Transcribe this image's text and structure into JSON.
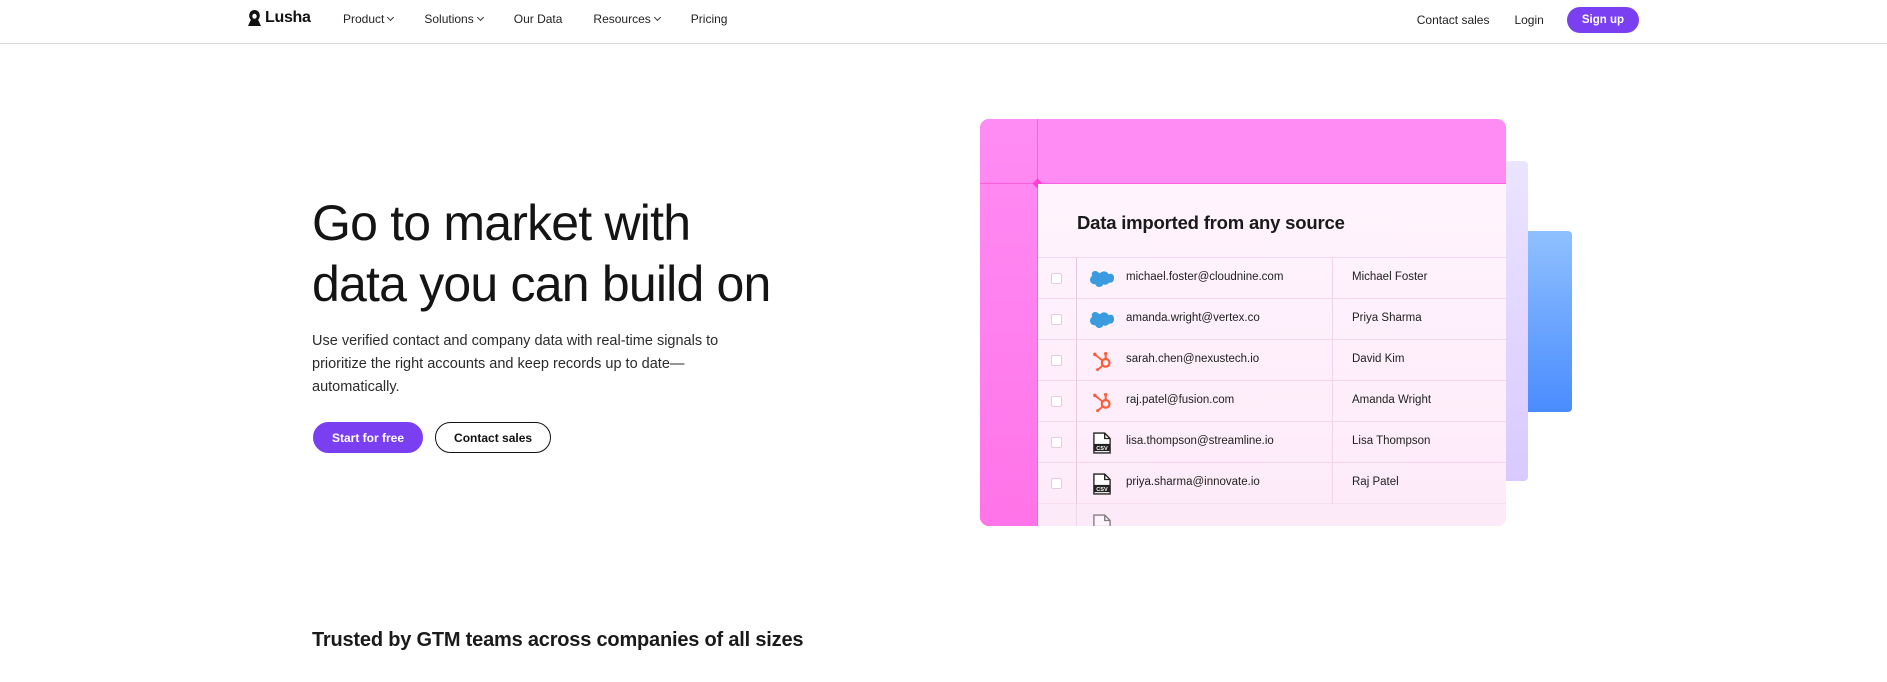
{
  "nav": {
    "logo_text": "Lusha",
    "links": [
      {
        "label": "Product",
        "dropdown": true
      },
      {
        "label": "Solutions",
        "dropdown": true
      },
      {
        "label": "Our Data",
        "dropdown": false
      },
      {
        "label": "Resources",
        "dropdown": true
      },
      {
        "label": "Pricing",
        "dropdown": false
      }
    ],
    "contact_sales": "Contact sales",
    "login": "Login",
    "signup": "Sign up"
  },
  "hero": {
    "title_line1": "Go to market with",
    "title_line2": "data you can build on",
    "description": "Use verified contact and company data with real-time signals to prioritize the right accounts and keep records up to date—automatically.",
    "primary_cta": "Start for free",
    "secondary_cta": "Contact sales"
  },
  "card": {
    "title": "Data imported from any source",
    "rows": [
      {
        "source": "salesforce-icon",
        "email": "michael.foster@cloudnine.com",
        "name": "Michael Foster"
      },
      {
        "source": "salesforce-icon",
        "email": "amanda.wright@vertex.co",
        "name": "Priya Sharma"
      },
      {
        "source": "hubspot-icon",
        "email": "sarah.chen@nexustech.io",
        "name": "David Kim"
      },
      {
        "source": "hubspot-icon",
        "email": "raj.patel@fusion.com",
        "name": "Amanda Wright"
      },
      {
        "source": "csv-icon",
        "email": "lisa.thompson@streamline.io",
        "name": "Lisa Thompson"
      },
      {
        "source": "csv-icon",
        "email": "priya.sharma@innovate.io",
        "name": "Raj Patel"
      }
    ]
  },
  "trusted": {
    "heading": "Trusted by GTM teams across companies of all sizes"
  },
  "colors": {
    "accent": "#7b3ff2",
    "card_pink": "#ff8cf5",
    "salesforce": "#1ea1e0",
    "hubspot": "#ff5c35"
  }
}
